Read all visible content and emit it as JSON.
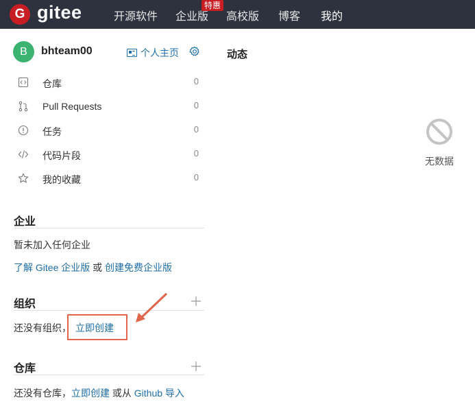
{
  "topbar": {
    "logo_letter": "G",
    "brand": "gitee",
    "nav": [
      "开源软件",
      "企业版",
      "高校版",
      "博客",
      "我的"
    ],
    "badge": "特惠"
  },
  "user": {
    "avatar_letter": "B",
    "name": "bhteam00",
    "homepage_label": "个人主页"
  },
  "menu": [
    {
      "icon": "code-repo-icon",
      "label": "仓库",
      "count": "0"
    },
    {
      "icon": "pull-request-icon",
      "label": "Pull Requests",
      "count": "0"
    },
    {
      "icon": "issue-icon",
      "label": "任务",
      "count": "0"
    },
    {
      "icon": "code-snippet-icon",
      "label": "代码片段",
      "count": "0"
    },
    {
      "icon": "star-icon",
      "label": "我的收藏",
      "count": "0"
    }
  ],
  "enterprise": {
    "title": "企业",
    "empty": "暂未加入任何企业",
    "link_learn": "了解 Gitee 企业版",
    "or": " 或 ",
    "link_create": "创建免费企业版"
  },
  "orgs": {
    "title": "组织",
    "empty_prefix": "还没有组织，",
    "create_link": "立即创建"
  },
  "repos": {
    "title": "仓库",
    "empty_prefix": "还没有仓库，",
    "create_link": "立即创建",
    "or_from": " 或从 ",
    "import_link": "Github 导入"
  },
  "feed": {
    "title": "动态",
    "empty": "无数据"
  },
  "colors": {
    "topbar": "#2d323e",
    "brand_red": "#c71d23",
    "link": "#1f6fa8",
    "annotation": "#e0664b",
    "avatar": "#3cb371"
  }
}
